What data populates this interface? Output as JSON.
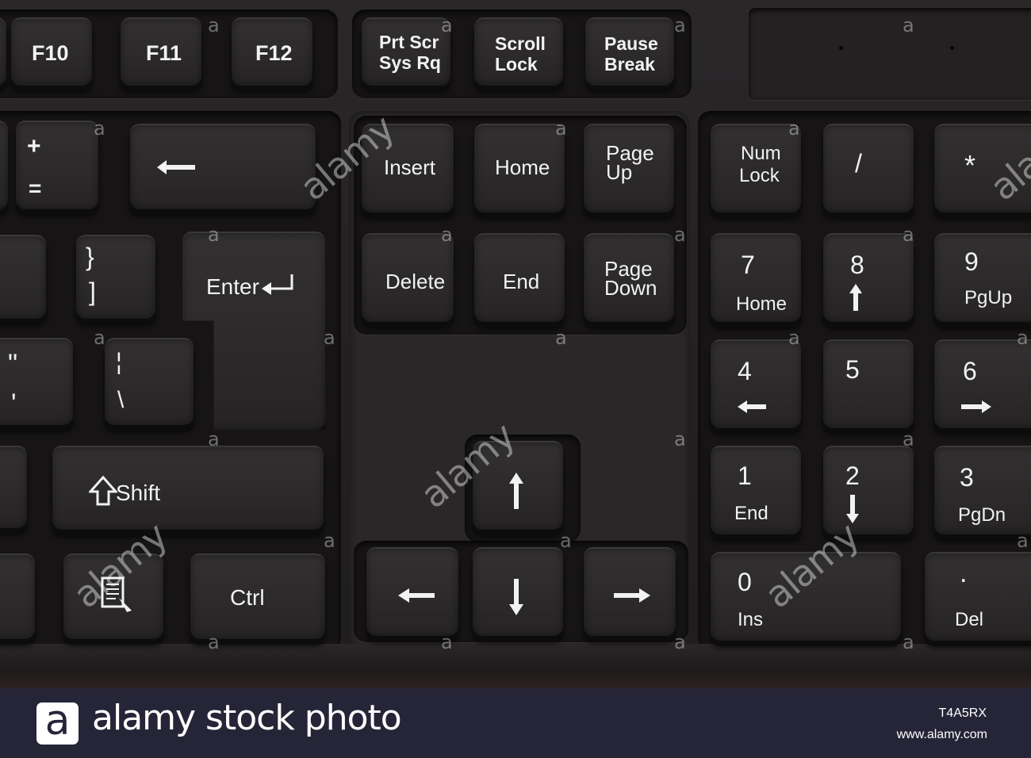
{
  "keyboard": {
    "function_keys": {
      "f10": "F10",
      "f11": "F11",
      "f12": "F12"
    },
    "system_keys": {
      "prtscr_top": "Prt Scr",
      "prtscr_bottom": "Sys Rq",
      "scroll_top": "Scroll",
      "scroll_bottom": "Lock",
      "pause_top": "Pause",
      "pause_bottom": "Break"
    },
    "main_keys": {
      "plus": "+",
      "equals": "=",
      "brace": "}",
      "bracket": "]",
      "enter": "Enter",
      "quote": "\"",
      "apostrophe": "'",
      "pipe": "¦",
      "backslash": "\\",
      "shift": "Shift",
      "ctrl": "Ctrl"
    },
    "nav_keys": {
      "insert": "Insert",
      "home": "Home",
      "pageup_top": "Page",
      "pageup_bottom": "Up",
      "delete": "Delete",
      "end": "End",
      "pagedown_top": "Page",
      "pagedown_bottom": "Down"
    },
    "numpad": {
      "numlock_top": "Num",
      "numlock_bottom": "Lock",
      "divide": "/",
      "multiply": "*",
      "seven": "7",
      "seven_sub": "Home",
      "eight": "8",
      "nine": "9",
      "nine_sub": "PgUp",
      "four": "4",
      "five": "5",
      "six": "6",
      "one": "1",
      "one_sub": "End",
      "two": "2",
      "three": "3",
      "three_sub": "PgDn",
      "zero": "0",
      "zero_sub": "Ins",
      "dot": ".",
      "dot_sub": "Del"
    },
    "watermark": {
      "word": "alamy",
      "letter": "a"
    },
    "icons": [
      "backspace-arrow-icon",
      "enter-arrow-icon",
      "shift-arrow-icon",
      "menu-key-icon",
      "arrow-up-icon",
      "arrow-down-icon",
      "arrow-left-icon",
      "arrow-right-icon"
    ]
  },
  "banner": {
    "logo_letter": "a",
    "brand": "alamy stock photo",
    "image_id": "T4A5RX",
    "site": "www.alamy.com",
    "background_color": "#262538"
  }
}
